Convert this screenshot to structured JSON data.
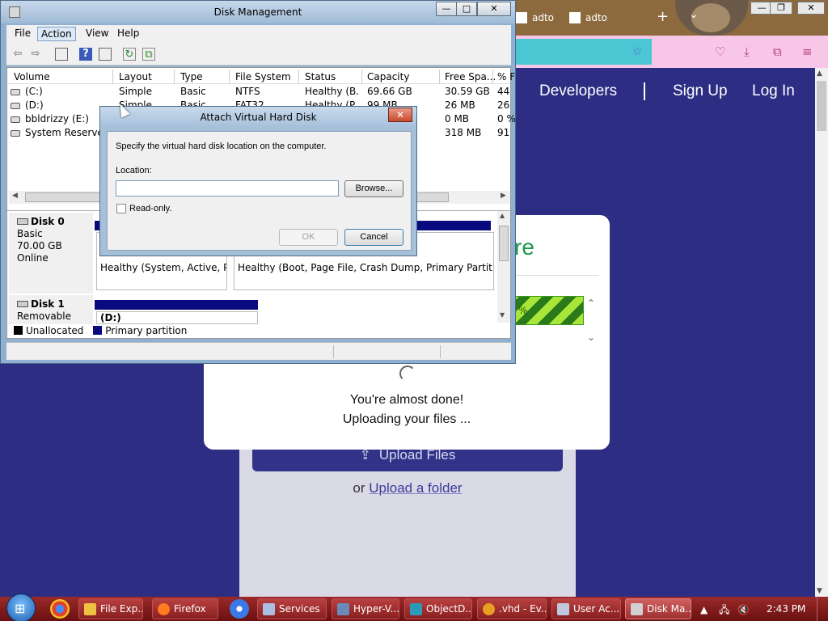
{
  "firefox": {
    "tabs": [
      {
        "label": "adto"
      },
      {
        "label": "adto"
      }
    ],
    "new_tab_icon": "plus-icon",
    "nav_icons": [
      "pocket-icon",
      "download-icon",
      "extensions-icon",
      "menu-icon"
    ],
    "site_nav": {
      "developers": "Developers",
      "sign_up": "Sign Up",
      "log_in": "Log In"
    },
    "card": {
      "heading_fragment": "re",
      "progress_fragment": "%",
      "message_line1": "You're almost done!",
      "message_line2": "Uploading your files ..."
    },
    "upload_button": "Upload Files",
    "folder_prefix": "or",
    "folder_link": "Upload a folder",
    "colors": {
      "site_bg": "#2d2d84",
      "heading_green": "#1a9a4a",
      "progress_green": "#a8e63a"
    }
  },
  "disk_management": {
    "title": "Disk Management",
    "menu": {
      "file": "File",
      "action": "Action",
      "view": "View",
      "help": "Help"
    },
    "toolbar_icons": [
      "back-icon",
      "forward-icon",
      "console-tree-icon",
      "help-icon",
      "properties-icon",
      "refresh-icon",
      "rescan-icon"
    ],
    "columns": [
      "Volume",
      "Layout",
      "Type",
      "File System",
      "Status",
      "Capacity",
      "Free Spa...",
      "% F"
    ],
    "volumes": [
      {
        "volume": "(C:)",
        "layout": "Simple",
        "type": "Basic",
        "fs": "NTFS",
        "status": "Healthy (B...",
        "capacity": "69.66 GB",
        "free": "30.59 GB",
        "pct": "44"
      },
      {
        "volume": "(D:)",
        "layout": "Simple",
        "type": "Basic",
        "fs": "FAT32",
        "status": "Healthy (P...",
        "capacity": "99 MB",
        "free": "26 MB",
        "pct": "26"
      },
      {
        "volume": "bbldrizzy (E:)",
        "layout": "",
        "type": "",
        "fs": "",
        "status": "",
        "capacity": "",
        "free": "0 MB",
        "pct": "0 %"
      },
      {
        "volume": "System Reserved",
        "layout": "",
        "type": "",
        "fs": "",
        "status": "",
        "capacity": "",
        "free": "318 MB",
        "pct": "91"
      }
    ],
    "disks": [
      {
        "name": "Disk 0",
        "type": "Basic",
        "size": "70.00 GB",
        "state": "Online",
        "partitions": [
          {
            "status": "Healthy (System, Active, Prim"
          },
          {
            "status": "Healthy (Boot, Page File, Crash Dump, Primary Partition)"
          }
        ]
      },
      {
        "name": "Disk 1",
        "type": "Removable",
        "partitions": [
          {
            "label": "(D:)"
          }
        ]
      }
    ],
    "legend": [
      {
        "label": "Unallocated",
        "color": "#000000"
      },
      {
        "label": "Primary partition",
        "color": "#0a0a80"
      }
    ]
  },
  "attach_vhd_dialog": {
    "title": "Attach Virtual Hard Disk",
    "instruction": "Specify the virtual hard disk location on the computer.",
    "location_label": "Location:",
    "location_value": "",
    "browse": "Browse...",
    "readonly_label": "Read-only.",
    "readonly_checked": false,
    "ok": "OK",
    "cancel": "Cancel"
  },
  "taskbar": {
    "tasks": [
      "File Exp...",
      "Firefox",
      "Services",
      "Hyper-V...",
      "ObjectD...",
      ".vhd - Ev...",
      "User Ac...",
      "Disk Ma..."
    ],
    "clock": "2:43 PM",
    "tray_icons": [
      "show-hidden-icon",
      "network-icon",
      "volume-muted-icon"
    ]
  }
}
